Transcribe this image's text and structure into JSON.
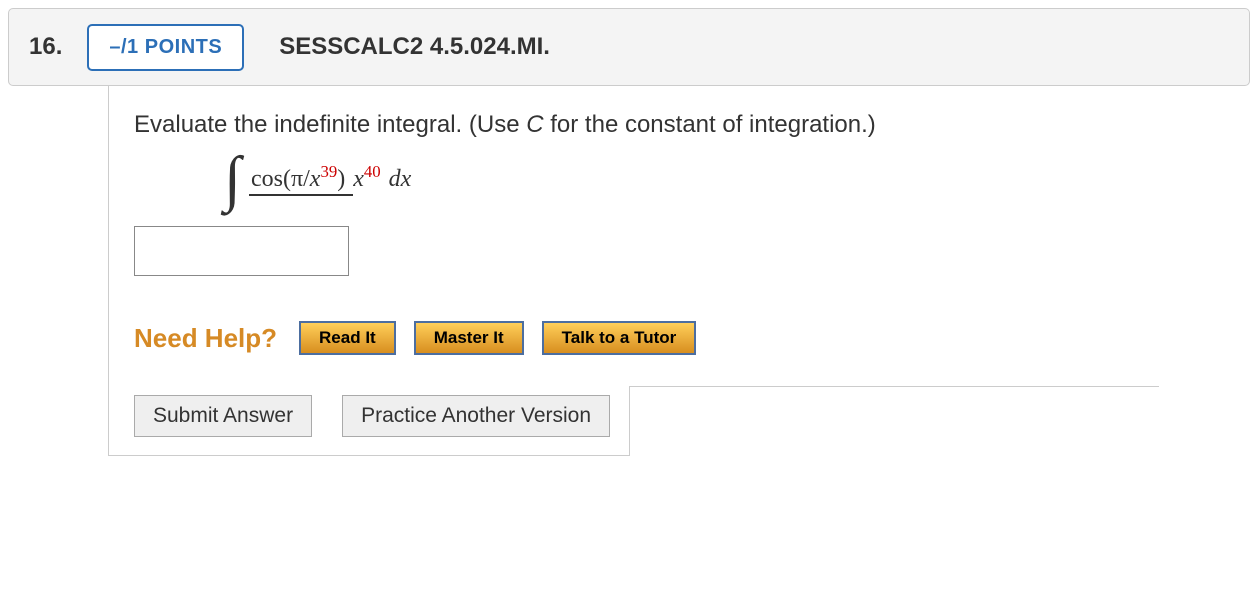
{
  "question": {
    "number": "16.",
    "points": "–/1 POINTS",
    "id": "SESSCALC2 4.5.024.MI.",
    "prompt_prefix": "Evaluate the indefinite integral. (Use ",
    "prompt_var": "C",
    "prompt_suffix": " for the constant of integration.)",
    "formula": {
      "func": "cos",
      "arg_prefix": "π/",
      "arg_base": "x",
      "arg_exp": "39",
      "den_base": "x",
      "den_exp": "40",
      "dx": "dx"
    }
  },
  "help": {
    "label": "Need Help?",
    "read": "Read It",
    "master": "Master It",
    "tutor": "Talk to a Tutor"
  },
  "actions": {
    "submit": "Submit Answer",
    "practice": "Practice Another Version"
  }
}
